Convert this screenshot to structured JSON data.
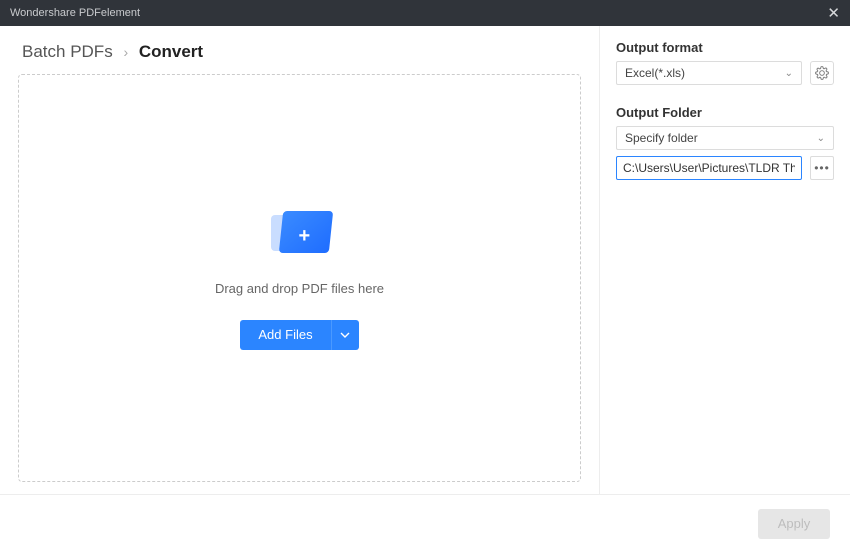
{
  "titlebar": {
    "title": "Wondershare PDFelement"
  },
  "breadcrumb": {
    "root": "Batch PDFs",
    "current": "Convert"
  },
  "dropzone": {
    "text": "Drag and drop PDF files here",
    "add_files_label": "Add Files"
  },
  "sidebar": {
    "output_format_label": "Output format",
    "output_format_value": "Excel(*.xls)",
    "output_folder_label": "Output Folder",
    "output_folder_mode": "Specify folder",
    "output_folder_path": "C:\\Users\\User\\Pictures\\TLDR This"
  },
  "footer": {
    "apply_label": "Apply"
  }
}
